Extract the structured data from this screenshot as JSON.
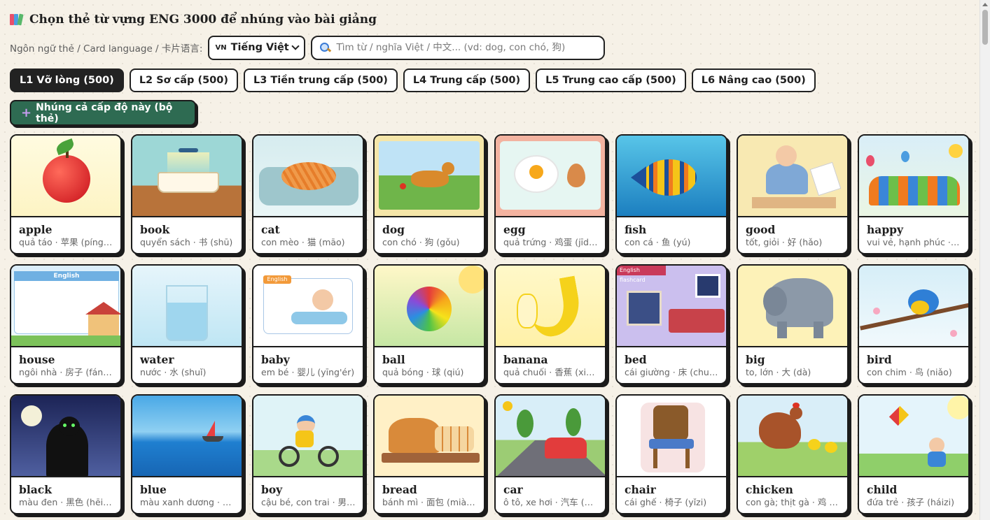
{
  "header": {
    "title": "Chọn thẻ từ vựng ENG 3000 để nhúng vào bài giảng",
    "icon": "books-icon"
  },
  "controls": {
    "lang_label": "Ngôn ngữ thẻ / Card language / 卡片语言:",
    "lang_flag": "VN",
    "lang_selected": "Tiếng Việt",
    "search_placeholder": "Tìm từ / nghĩa Việt / 中文... (vd: dog, con chó, 狗)",
    "search_value": ""
  },
  "levels": [
    {
      "label": "L1 Vỡ lòng (500)",
      "active": true
    },
    {
      "label": "L2 Sơ cấp (500)",
      "active": false
    },
    {
      "label": "L3 Tiền trung cấp (500)",
      "active": false
    },
    {
      "label": "L4 Trung cấp (500)",
      "active": false
    },
    {
      "label": "L5 Trung cao cấp (500)",
      "active": false
    },
    {
      "label": "L6 Nâng cao (500)",
      "active": false
    }
  ],
  "embed_button": {
    "label": "Nhúng cả cấp độ này (bộ thẻ)"
  },
  "cards": [
    {
      "word": "apple",
      "meaning": "quả táo · 苹果 (píngguǒ)",
      "scene": "apple"
    },
    {
      "word": "book",
      "meaning": "quyển sách · 书 (shū)",
      "scene": "book"
    },
    {
      "word": "cat",
      "meaning": "con mèo · 猫 (māo)",
      "scene": "cat"
    },
    {
      "word": "dog",
      "meaning": "con chó · 狗 (gǒu)",
      "scene": "dog"
    },
    {
      "word": "egg",
      "meaning": "quả trứng · 鸡蛋 (jīdàn)",
      "scene": "egg"
    },
    {
      "word": "fish",
      "meaning": "con cá · 鱼 (yú)",
      "scene": "fish"
    },
    {
      "word": "good",
      "meaning": "tốt, giỏi · 好 (hǎo)",
      "scene": "good"
    },
    {
      "word": "happy",
      "meaning": "vui vẻ, hạnh phúc · 快乐",
      "scene": "happy"
    },
    {
      "word": "house",
      "meaning": "ngôi nhà · 房子 (fángzi)",
      "scene": "house"
    },
    {
      "word": "water",
      "meaning": "nước · 水 (shuǐ)",
      "scene": "water"
    },
    {
      "word": "baby",
      "meaning": "em bé · 婴儿 (yīng'ér)",
      "scene": "baby"
    },
    {
      "word": "ball",
      "meaning": "quả bóng · 球 (qiú)",
      "scene": "ball"
    },
    {
      "word": "banana",
      "meaning": "quả chuối · 香蕉 (xiāngjiāo)",
      "scene": "banana"
    },
    {
      "word": "bed",
      "meaning": "cái giường · 床 (chuáng)",
      "scene": "bed"
    },
    {
      "word": "big",
      "meaning": "to, lớn · 大 (dà)",
      "scene": "big"
    },
    {
      "word": "bird",
      "meaning": "con chim · 鸟 (niǎo)",
      "scene": "bird"
    },
    {
      "word": "black",
      "meaning": "màu đen · 黑色 (hēisè)",
      "scene": "black"
    },
    {
      "word": "blue",
      "meaning": "màu xanh dương · 蓝色 (lánsè)",
      "scene": "blue"
    },
    {
      "word": "boy",
      "meaning": "cậu bé, con trai · 男孩 (nánhái)",
      "scene": "boy"
    },
    {
      "word": "bread",
      "meaning": "bánh mì · 面包 (miànbāo)",
      "scene": "bread"
    },
    {
      "word": "car",
      "meaning": "ô tô, xe hơi · 汽车 (qìchē)",
      "scene": "car"
    },
    {
      "word": "chair",
      "meaning": "cái ghế · 椅子 (yǐzi)",
      "scene": "chair"
    },
    {
      "word": "chicken",
      "meaning": "con gà; thịt gà · 鸡 (jī)",
      "scene": "chicken"
    },
    {
      "word": "child",
      "meaning": "đứa trẻ · 孩子 (háizi)",
      "scene": "child"
    }
  ],
  "image_labels": {
    "house_card": "English",
    "baby_card": "English",
    "bed_card": "English flashcard"
  },
  "colors": {
    "active_tab": "#222222",
    "embed_button": "#2e6b52",
    "background": "#f6f1e7"
  }
}
